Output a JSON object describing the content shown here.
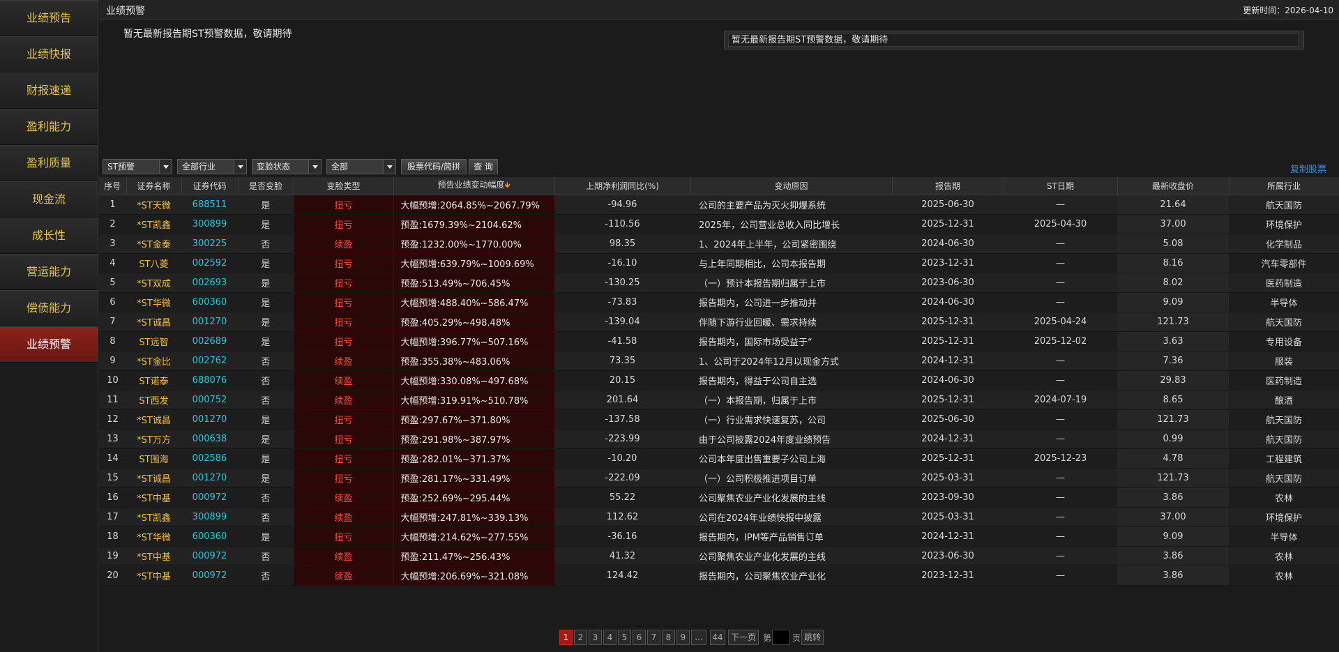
{
  "sidebar": {
    "items": [
      {
        "label": "业绩预告"
      },
      {
        "label": "业绩快报"
      },
      {
        "label": "财报速递"
      },
      {
        "label": "盈利能力"
      },
      {
        "label": "盈利质量"
      },
      {
        "label": "现金流"
      },
      {
        "label": "成长性"
      },
      {
        "label": "营运能力"
      },
      {
        "label": "偿债能力"
      },
      {
        "label": "业绩预警"
      }
    ],
    "active": "业绩预警"
  },
  "header": {
    "title": "业绩预警",
    "update_time": "更新时间：2026-04-10"
  },
  "notice": {
    "left_text": "暂无最新报告期ST预警数据，敬请期待",
    "box_text": "暂无最新报告期ST预警数据，敬请期待"
  },
  "filters": {
    "st_select": "ST预警",
    "industry_select": "全部行业",
    "status_select": "变脸状态",
    "all_select": "全部",
    "search_button": "股票代码/简拼",
    "query_button": "查 询",
    "copy_link": "复制股票"
  },
  "table": {
    "headers": {
      "idx": "序号",
      "name": "证券名称",
      "code": "证券代码",
      "changed": "是否变脸",
      "type": "变脸类型",
      "range": "预告业绩变动幅度",
      "yoy": "上期净利润同比(%)",
      "reason": "变动原因",
      "report": "报告期",
      "st_date": "ST日期",
      "price": "最新收盘价",
      "industry": "所属行业"
    },
    "sort_arrow": "🡻",
    "rows": [
      {
        "idx": "1",
        "name": "*ST天微",
        "code": "688511",
        "changed": "是",
        "type": "扭亏",
        "range": "大幅预增:2064.85%~2067.79%",
        "yoy": "-94.96",
        "reason": "公司的主要产品为灭火抑爆系统",
        "report": "2025-06-30",
        "st_date": "—",
        "price": "21.64",
        "industry": "航天国防"
      },
      {
        "idx": "2",
        "name": "*ST凯鑫",
        "code": "300899",
        "changed": "是",
        "type": "扭亏",
        "range": "预盈:1679.39%~2104.62%",
        "yoy": "-110.56",
        "reason": "2025年，公司营业总收入同比增长",
        "report": "2025-12-31",
        "st_date": "2025-04-30",
        "price": "37.00",
        "industry": "环境保护"
      },
      {
        "idx": "3",
        "name": "*ST金泰",
        "code": "300225",
        "changed": "否",
        "type": "续盈",
        "range": "预盈:1232.00%~1770.00%",
        "yoy": "98.35",
        "reason": "1、2024年上半年，公司紧密围绕",
        "report": "2024-06-30",
        "st_date": "—",
        "price": "5.08",
        "industry": "化学制品"
      },
      {
        "idx": "4",
        "name": "ST八菱",
        "code": "002592",
        "changed": "是",
        "type": "扭亏",
        "range": "大幅预增:639.79%~1009.69%",
        "yoy": "-16.10",
        "reason": "与上年同期相比，公司本报告期",
        "report": "2023-12-31",
        "st_date": "—",
        "price": "8.16",
        "industry": "汽车零部件"
      },
      {
        "idx": "5",
        "name": "*ST双成",
        "code": "002693",
        "changed": "是",
        "type": "扭亏",
        "range": "预盈:513.49%~706.45%",
        "yoy": "-130.25",
        "reason": "（一）预计本报告期归属于上市",
        "report": "2023-06-30",
        "st_date": "—",
        "price": "8.02",
        "industry": "医药制造"
      },
      {
        "idx": "6",
        "name": "*ST华微",
        "code": "600360",
        "changed": "是",
        "type": "扭亏",
        "range": "大幅预增:488.40%~586.47%",
        "yoy": "-73.83",
        "reason": "报告期内，公司进一步推动并",
        "report": "2024-06-30",
        "st_date": "—",
        "price": "9.09",
        "industry": "半导体"
      },
      {
        "idx": "7",
        "name": "*ST诚昌",
        "code": "001270",
        "changed": "是",
        "type": "扭亏",
        "range": "预盈:405.29%~498.48%",
        "yoy": "-139.04",
        "reason": "伴随下游行业回暖、需求持续",
        "report": "2025-12-31",
        "st_date": "2025-04-24",
        "price": "121.73",
        "industry": "航天国防"
      },
      {
        "idx": "8",
        "name": "ST远智",
        "code": "002689",
        "changed": "是",
        "type": "扭亏",
        "range": "大幅预增:396.77%~507.16%",
        "yoy": "-41.58",
        "reason": "报告期内，国际市场受益于“",
        "report": "2025-12-31",
        "st_date": "2025-12-02",
        "price": "3.63",
        "industry": "专用设备"
      },
      {
        "idx": "9",
        "name": "*ST金比",
        "code": "002762",
        "changed": "否",
        "type": "续盈",
        "range": "预盈:355.38%~483.06%",
        "yoy": "73.35",
        "reason": "1、公司于2024年12月以现金方式",
        "report": "2024-12-31",
        "st_date": "—",
        "price": "7.36",
        "industry": "服装"
      },
      {
        "idx": "10",
        "name": "ST诺泰",
        "code": "688076",
        "changed": "否",
        "type": "续盈",
        "range": "大幅预增:330.08%~497.68%",
        "yoy": "20.15",
        "reason": "报告期内，得益于公司自主选",
        "report": "2024-06-30",
        "st_date": "—",
        "price": "29.83",
        "industry": "医药制造"
      },
      {
        "idx": "11",
        "name": "ST西发",
        "code": "000752",
        "changed": "否",
        "type": "续盈",
        "range": "大幅预增:319.91%~510.78%",
        "yoy": "201.64",
        "reason": "（一）本报告期，归属于上市",
        "report": "2025-12-31",
        "st_date": "2024-07-19",
        "price": "8.65",
        "industry": "酿酒"
      },
      {
        "idx": "12",
        "name": "*ST诚昌",
        "code": "001270",
        "changed": "是",
        "type": "扭亏",
        "range": "预盈:297.67%~371.80%",
        "yoy": "-137.58",
        "reason": "（一）行业需求快速复苏，公司",
        "report": "2025-06-30",
        "st_date": "—",
        "price": "121.73",
        "industry": "航天国防"
      },
      {
        "idx": "13",
        "name": "*ST万方",
        "code": "000638",
        "changed": "是",
        "type": "扭亏",
        "range": "预盈:291.98%~387.97%",
        "yoy": "-223.99",
        "reason": "由于公司披露2024年度业绩预告",
        "report": "2024-12-31",
        "st_date": "—",
        "price": "0.99",
        "industry": "航天国防"
      },
      {
        "idx": "14",
        "name": "ST围海",
        "code": "002586",
        "changed": "是",
        "type": "扭亏",
        "range": "预盈:282.01%~371.37%",
        "yoy": "-10.20",
        "reason": "公司本年度出售重要子公司上海",
        "report": "2025-12-31",
        "st_date": "2025-12-23",
        "price": "4.78",
        "industry": "工程建筑"
      },
      {
        "idx": "15",
        "name": "*ST诚昌",
        "code": "001270",
        "changed": "是",
        "type": "扭亏",
        "range": "预盈:281.17%~331.49%",
        "yoy": "-222.09",
        "reason": "（一）公司积极推进项目订单",
        "report": "2025-03-31",
        "st_date": "—",
        "price": "121.73",
        "industry": "航天国防"
      },
      {
        "idx": "16",
        "name": "*ST中基",
        "code": "000972",
        "changed": "否",
        "type": "续盈",
        "range": "预盈:252.69%~295.44%",
        "yoy": "55.22",
        "reason": "公司聚焦农业产业化发展的主线",
        "report": "2023-09-30",
        "st_date": "—",
        "price": "3.86",
        "industry": "农林"
      },
      {
        "idx": "17",
        "name": "*ST凯鑫",
        "code": "300899",
        "changed": "否",
        "type": "续盈",
        "range": "大幅预增:247.81%~339.13%",
        "yoy": "112.62",
        "reason": "公司在2024年业绩快报中披露",
        "report": "2025-03-31",
        "st_date": "—",
        "price": "37.00",
        "industry": "环境保护"
      },
      {
        "idx": "18",
        "name": "*ST华微",
        "code": "600360",
        "changed": "是",
        "type": "扭亏",
        "range": "大幅预增:214.62%~277.55%",
        "yoy": "-36.16",
        "reason": "报告期内，IPM等产品销售订单",
        "report": "2024-12-31",
        "st_date": "—",
        "price": "9.09",
        "industry": "半导体"
      },
      {
        "idx": "19",
        "name": "*ST中基",
        "code": "000972",
        "changed": "否",
        "type": "续盈",
        "range": "预盈:211.47%~256.43%",
        "yoy": "41.32",
        "reason": "公司聚焦农业产业化发展的主线",
        "report": "2023-06-30",
        "st_date": "—",
        "price": "3.86",
        "industry": "农林"
      },
      {
        "idx": "20",
        "name": "*ST中基",
        "code": "000972",
        "changed": "否",
        "type": "续盈",
        "range": "大幅预增:206.69%~321.08%",
        "yoy": "124.42",
        "reason": "报告期内，公司聚焦农业产业化",
        "report": "2023-12-31",
        "st_date": "—",
        "price": "3.86",
        "industry": "农林"
      }
    ]
  },
  "pagination": {
    "pages": [
      "1",
      "2",
      "3",
      "4",
      "5",
      "6",
      "7",
      "8",
      "9",
      "...",
      "44"
    ],
    "current": "1",
    "next_label": "下一页",
    "page_prefix": "第",
    "page_suffix": "页",
    "jump_label": "跳转"
  },
  "colors": {
    "accent_red": "#8a231b",
    "name_yellow": "#f0c040",
    "code_cyan": "#24c8d8",
    "link_blue": "#2f8fe0",
    "type_red": "#ff4a3a"
  }
}
